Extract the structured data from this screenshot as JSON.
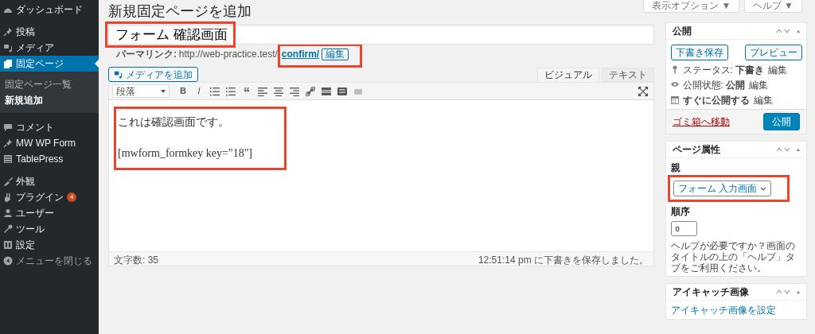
{
  "sidebar": {
    "items": [
      {
        "label": "ダッシュボード",
        "selected": false
      },
      {
        "label": "投稿",
        "selected": false
      },
      {
        "label": "メディア",
        "selected": false
      },
      {
        "label": "固定ページ",
        "selected": true,
        "children": [
          {
            "label": "固定ページ一覧",
            "selected": false
          },
          {
            "label": "新規追加",
            "selected": true
          }
        ]
      },
      {
        "label": "コメント",
        "selected": false
      },
      {
        "label": "MW WP Form",
        "selected": false
      },
      {
        "label": "TablePress",
        "selected": false
      },
      {
        "label": "外観",
        "selected": false
      },
      {
        "label": "プラグイン",
        "selected": false,
        "badge": "4"
      },
      {
        "label": "ユーザー",
        "selected": false
      },
      {
        "label": "ツール",
        "selected": false
      },
      {
        "label": "設定",
        "selected": false
      }
    ],
    "collapse": "メニューを閉じる"
  },
  "screen_buttons": [
    {
      "label": "表示オプション ▼"
    },
    {
      "label": "ヘルプ ▼"
    }
  ],
  "page_title": "新規固定ページを追加",
  "title_field": {
    "value": "フォーム 確認画面",
    "highlighted": true
  },
  "permalink": {
    "label": "パーマリンク:",
    "url_base": "http://web-practice.test/",
    "slug": "confirm/",
    "edit_button": "編集",
    "highlighted": true
  },
  "add_media_button": "メディアを追加",
  "editor_tabs": [
    {
      "label": "ビジュアル",
      "selected": true
    },
    {
      "label": "テキスト",
      "selected": false
    }
  ],
  "toolbar": {
    "format": "段落",
    "buttons": [
      {
        "kind": "bold",
        "label": "B"
      },
      {
        "kind": "italic",
        "label": "I"
      },
      {
        "kind": "bullets"
      },
      {
        "kind": "numbers"
      },
      {
        "kind": "quote",
        "label": "“"
      },
      {
        "kind": "align-left"
      },
      {
        "kind": "align-center"
      },
      {
        "kind": "align-right"
      },
      {
        "kind": "link"
      },
      {
        "kind": "more"
      },
      {
        "kind": "keyboard"
      },
      {
        "kind": "toolbar-toggle"
      }
    ]
  },
  "content": {
    "paragraphs": [
      "これは確認画面です。",
      "[mwform_formkey key=\"18\"]"
    ],
    "highlighted": true
  },
  "status_bar": {
    "word_count": "文字数: 35",
    "saved": "12:51:14 pm に下書きを保存しました。"
  },
  "publish_box": {
    "title": "公開",
    "save_draft": "下書き保存",
    "preview": "プレビュー",
    "rows": [
      {
        "label": "ステータス: ",
        "value": "下書き",
        "edit": "編集"
      },
      {
        "label": "公開状態: ",
        "value": "公開",
        "edit": "編集"
      },
      {
        "label": "",
        "value": "すぐに公開する",
        "edit": "編集"
      }
    ],
    "trash": "ゴミ箱へ移動",
    "publish": "公開"
  },
  "attributes_box": {
    "title": "ページ属性",
    "parent_label": "親",
    "parent": "フォーム 入力画面",
    "highlighted": true,
    "order_label": "順序",
    "order": "0",
    "help": "ヘルプが必要ですか？画面のタイトルの上の「ヘルプ」タブをご利用ください。"
  },
  "featured_box": {
    "title": "アイキャッチ画像",
    "link": "アイキャッチ画像を設定"
  }
}
